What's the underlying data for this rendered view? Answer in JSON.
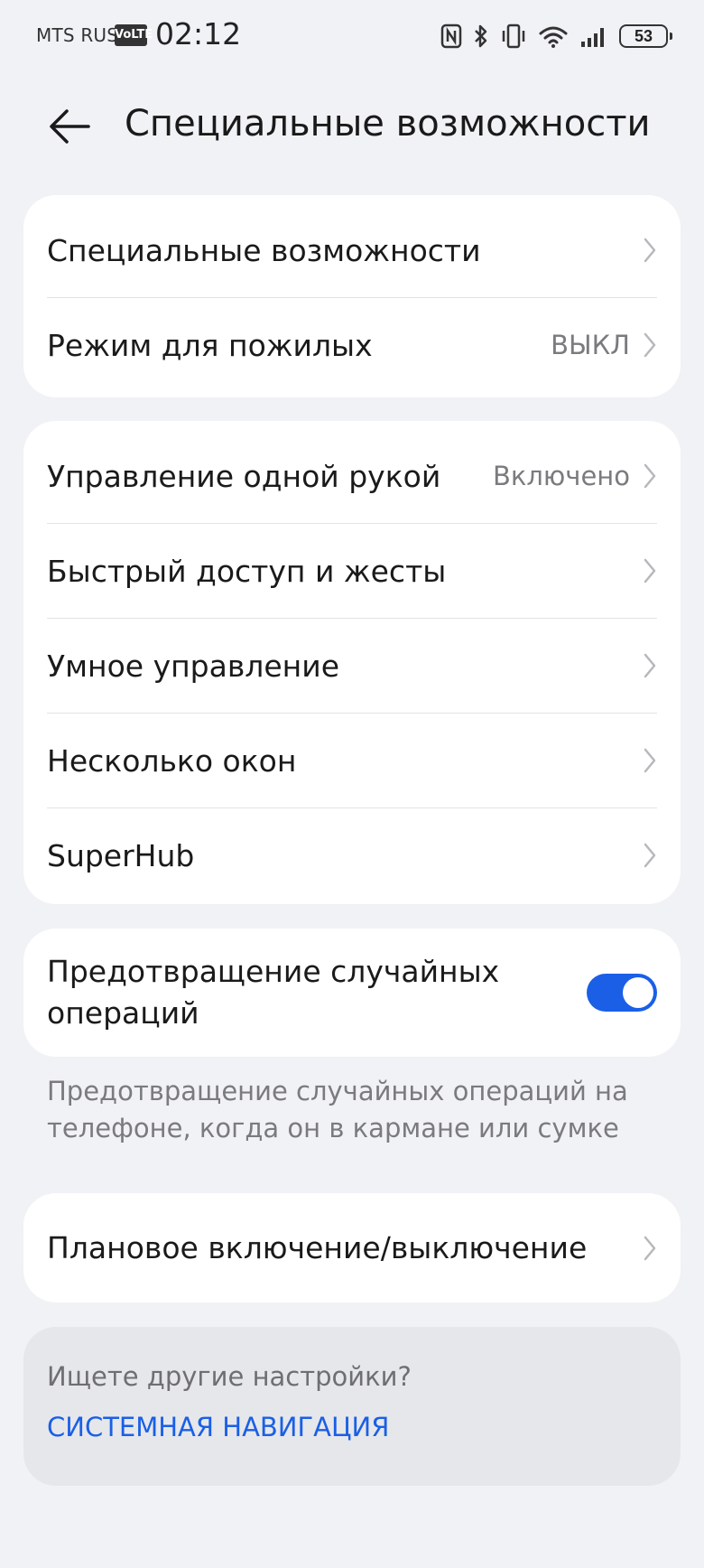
{
  "status_bar": {
    "carrier": "MTS RUS",
    "volte": "VoLTE",
    "time": "02:12",
    "battery": "53",
    "icons": [
      "nfc-icon",
      "bluetooth-icon",
      "vibrate-icon",
      "wifi-icon",
      "signal-icon",
      "battery-icon"
    ]
  },
  "header": {
    "title": "Специальные возможности",
    "back_icon": "back-arrow-icon"
  },
  "group1": {
    "items": [
      {
        "label": "Специальные возможности",
        "value": ""
      },
      {
        "label": "Режим для пожилых",
        "value": "ВЫКЛ"
      }
    ]
  },
  "group2": {
    "items": [
      {
        "label": "Управление одной рукой",
        "value": "Включено"
      },
      {
        "label": "Быстрый доступ и жесты",
        "value": ""
      },
      {
        "label": "Умное управление",
        "value": ""
      },
      {
        "label": "Несколько окон",
        "value": ""
      },
      {
        "label": "SuperHub",
        "value": ""
      }
    ]
  },
  "accidental": {
    "label": "Предотвращение случайных операций",
    "enabled": true,
    "hint": "Предотвращение случайных операций на телефоне, когда он в кармане или сумке"
  },
  "scheduled": {
    "label": "Плановое включение/выключение"
  },
  "search": {
    "question": "Ищете другие настройки?",
    "link": "СИСТЕМНАЯ НАВИГАЦИЯ"
  },
  "colors": {
    "background": "#f1f2f6",
    "card": "#ffffff",
    "accent": "#1a5fe6",
    "secondary_text": "#7b7b7f"
  }
}
